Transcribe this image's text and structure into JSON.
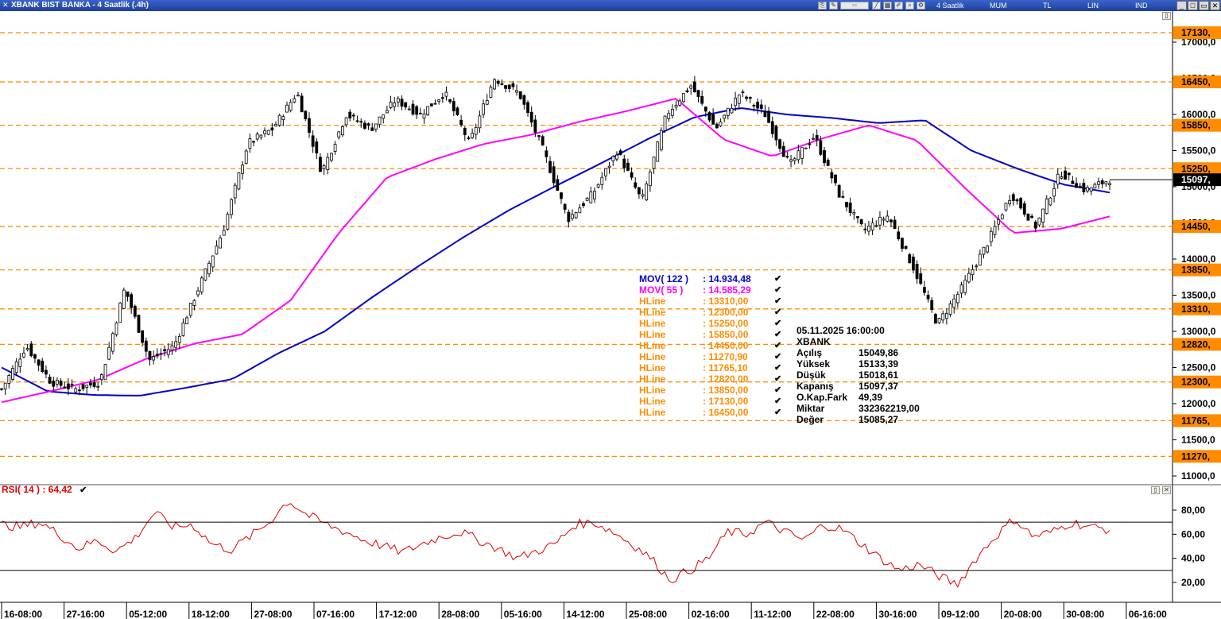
{
  "window": {
    "title": "XBANK BIST BANKA - 4 Saatlik (.4h)",
    "modes": [
      "4 Saatlik",
      "MUM",
      "TL",
      "LIN",
      "IND"
    ]
  },
  "price_axis_labels": [
    "17000,0",
    "16500,0",
    "16000,0",
    "15500,0",
    "15000,0",
    "14500,0",
    "14000,0",
    "13500,0",
    "13000,0",
    "12500,0",
    "12000,0",
    "11500,0",
    "11000,0"
  ],
  "hline_axis_labels": [
    "17130,",
    "16450,",
    "15850,",
    "15250,",
    "14450,",
    "13850,",
    "13310,",
    "12820,",
    "12300,",
    "11765,",
    "11270,"
  ],
  "last_price_label": "15097,",
  "rsi_axis_labels": [
    "80,00",
    "60,00",
    "40,00",
    "20,00"
  ],
  "date_labels": [
    "16-08:00",
    "27-16:00",
    "05-12:00",
    "18-12:00",
    "27-08:00",
    "07-16:00",
    "17-12:00",
    "28-08:00",
    "05-16:00",
    "14-12:00",
    "25-08:00",
    "02-16:00",
    "11-12:00",
    "22-08:00",
    "30-16:00",
    "09-12:00",
    "20-08:00",
    "30-08:00",
    "06-16:00"
  ],
  "legend": [
    {
      "name": "MOV( 122 )",
      "value": ": 14.934,48",
      "color": "#0000cc"
    },
    {
      "name": "MOV( 55 )",
      "value": ": 14.585,29",
      "color": "#ff00ff"
    },
    {
      "name": "HLine",
      "value": ": 13310,00",
      "color": "#ff8c00"
    },
    {
      "name": "HLine",
      "value": ": 12300,00",
      "color": "#ff8c00"
    },
    {
      "name": "HLine",
      "value": ": 15250,00",
      "color": "#ff8c00"
    },
    {
      "name": "HLine",
      "value": ": 15850,00",
      "color": "#ff8c00"
    },
    {
      "name": "HLine",
      "value": ": 14450,00",
      "color": "#ff8c00"
    },
    {
      "name": "HLine",
      "value": ": 11270,90",
      "color": "#ff8c00"
    },
    {
      "name": "HLine",
      "value": ": 11765,10",
      "color": "#ff8c00"
    },
    {
      "name": "HLine",
      "value": ": 12820,00",
      "color": "#ff8c00"
    },
    {
      "name": "HLine",
      "value": ": 13850,00",
      "color": "#ff8c00"
    },
    {
      "name": "HLine",
      "value": ": 17130,00",
      "color": "#ff8c00"
    },
    {
      "name": "HLine",
      "value": ": 16450,00",
      "color": "#ff8c00"
    }
  ],
  "info_box": {
    "datetime": "05.11.2025  16:00:00",
    "symbol": "XBANK",
    "rows": [
      {
        "label": "Açılış",
        "value": "15049,86"
      },
      {
        "label": "Yüksek",
        "value": "15133,39"
      },
      {
        "label": "Düşük",
        "value": "15018,61"
      },
      {
        "label": "Kapanış",
        "value": "15097,37"
      },
      {
        "label": "O.Kap.Fark",
        "value": "49,39"
      },
      {
        "label": "Miktar",
        "value": "332362219,00"
      },
      {
        "label": "Değer",
        "value": "15085,27"
      }
    ]
  },
  "rsi_panel": {
    "label": "RSI( 14 )   : 64,42",
    "color": "#e00000"
  },
  "colors": {
    "hline": "#ff8c00",
    "mov122": "#0000cc",
    "mov55": "#ff00ff",
    "rsi": "#e00000",
    "candle": "#000000",
    "titlebar": "#2a4fb0"
  },
  "chart_data": [
    {
      "type": "candlestick",
      "title": "XBANK BIST BANKA - 4 Saatlik (.4h)",
      "ylim": [
        11000,
        17000
      ],
      "hlines": [
        17130,
        16450,
        15850,
        15250,
        14450,
        13850,
        13310,
        12820,
        12300,
        11765.1,
        11270.9
      ],
      "last_close": 15097.37,
      "price_anchors": [
        12200,
        12800,
        12300,
        12200,
        12300,
        13600,
        12600,
        12800,
        13600,
        14400,
        15600,
        15800,
        16300,
        15200,
        16000,
        15800,
        16200,
        16000,
        16300,
        15600,
        16500,
        16300,
        15500,
        14550,
        14900,
        15500,
        14800,
        16000,
        16400,
        15800,
        16300,
        16000,
        15300,
        15700,
        14900,
        14400,
        14600,
        13900,
        13100,
        13600,
        14200,
        14900,
        14450,
        15200,
        14950,
        15100
      ],
      "series": [
        {
          "name": "MOV( 122 )",
          "last_value": 14934.48,
          "anchors": [
            12500,
            12170,
            12120,
            12110,
            12220,
            12340,
            12700,
            13000,
            13460,
            13890,
            14300,
            14680,
            15010,
            15330,
            15660,
            15960,
            16090,
            16000,
            15950,
            15880,
            15920,
            15500,
            15250,
            15030,
            14920
          ]
        },
        {
          "name": "MOV( 55 )",
          "last_value": 14585.29,
          "anchors": [
            12020,
            12170,
            12330,
            12620,
            12830,
            12960,
            13430,
            14360,
            15130,
            15380,
            15590,
            15720,
            15900,
            16050,
            16220,
            15650,
            15420,
            15660,
            15850,
            15640,
            14980,
            14360,
            14420,
            14590
          ]
        },
        {
          "name": "RSI( 14 )",
          "last_value": 64.42,
          "ylim": [
            10,
            95
          ],
          "anchors": [
            68,
            66,
            70,
            60,
            48,
            55,
            46,
            57,
            78,
            66,
            68,
            52,
            47,
            58,
            70,
            88,
            76,
            68,
            62,
            55,
            50,
            45,
            52,
            58,
            62,
            55,
            48,
            40,
            46,
            52,
            68,
            70,
            62,
            52,
            40,
            22,
            30,
            40,
            62,
            60,
            70,
            62,
            55,
            68,
            64,
            52,
            40,
            30,
            35,
            26,
            18,
            40,
            58,
            73,
            58,
            62,
            70,
            66,
            64
          ]
        }
      ]
    }
  ]
}
